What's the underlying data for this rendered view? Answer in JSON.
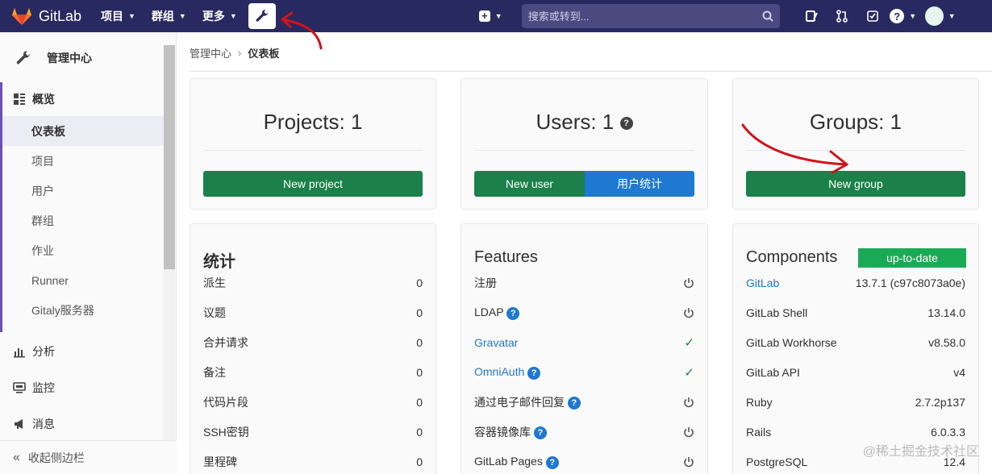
{
  "navbar": {
    "brand": "GitLab",
    "menus": [
      "项目",
      "群组",
      "更多"
    ],
    "search_placeholder": "搜索或转到..."
  },
  "sidebar": {
    "header": "管理中心",
    "group_title": "概览",
    "group_items": [
      "仪表板",
      "项目",
      "用户",
      "群组",
      "作业",
      "Runner",
      "Gitaly服务器"
    ],
    "items": [
      "分析",
      "监控",
      "消息"
    ],
    "collapse": "收起侧边栏"
  },
  "breadcrumb": {
    "parent": "管理中心",
    "current": "仪表板"
  },
  "counts": {
    "projects": "Projects: 1",
    "users": "Users: 1",
    "groups": "Groups: 1",
    "new_project": "New project",
    "new_user": "New user",
    "user_stats": "用户统计",
    "new_group": "New group"
  },
  "stats": {
    "title": "统计",
    "rows": [
      {
        "label": "派生",
        "value": "0"
      },
      {
        "label": "议题",
        "value": "0"
      },
      {
        "label": "合并请求",
        "value": "0"
      },
      {
        "label": "备注",
        "value": "0"
      },
      {
        "label": "代码片段",
        "value": "0"
      },
      {
        "label": "SSH密钥",
        "value": "0"
      },
      {
        "label": "里程碑",
        "value": "0"
      }
    ]
  },
  "features": {
    "title": "Features",
    "rows": [
      {
        "label": "注册",
        "state": "off"
      },
      {
        "label": "LDAP",
        "state": "off"
      },
      {
        "label": "Gravatar",
        "state": "on"
      },
      {
        "label": "OmniAuth",
        "state": "on"
      },
      {
        "label": "通过电子邮件回复",
        "state": "off"
      },
      {
        "label": "容器镜像库",
        "state": "off"
      },
      {
        "label": "GitLab Pages",
        "state": "off"
      }
    ]
  },
  "components": {
    "title": "Components",
    "badge": "up-to-date",
    "rows": [
      {
        "label": "GitLab",
        "value": "13.7.1 (c97c8073a0e)"
      },
      {
        "label": "GitLab Shell",
        "value": "13.14.0"
      },
      {
        "label": "GitLab Workhorse",
        "value": "v8.58.0"
      },
      {
        "label": "GitLab API",
        "value": "v4"
      },
      {
        "label": "Ruby",
        "value": "2.7.2p137"
      },
      {
        "label": "Rails",
        "value": "6.0.3.3"
      },
      {
        "label": "PostgreSQL",
        "value": "12.4"
      }
    ]
  },
  "watermark": "@稀土掘金技术社区",
  "colors": {
    "navbar": "#292961",
    "green": "#1b8049",
    "blue": "#1f78d1",
    "badge": "#1aaa55",
    "annotation": "#d0131b"
  }
}
